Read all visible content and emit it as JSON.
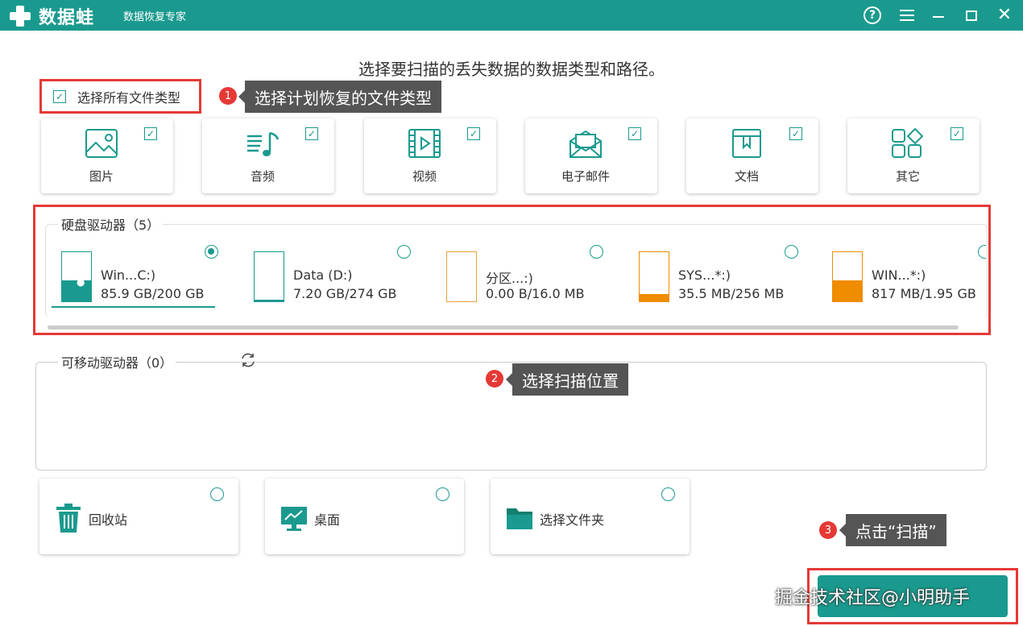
{
  "app": {
    "name": "数据蛙",
    "subtitle": "数据恢复专家",
    "help_icon": "?",
    "close_icon": "✕"
  },
  "instruction": "选择要扫描的丢失数据的数据类型和路径。",
  "select_all": {
    "label": "选择所有文件类型",
    "checked": true
  },
  "callouts": [
    {
      "num": "1",
      "text": "选择计划恢复的文件类型"
    },
    {
      "num": "2",
      "text": "选择扫描位置"
    },
    {
      "num": "3",
      "text": "点击“扫描”"
    }
  ],
  "file_types": [
    {
      "label": "图片",
      "icon": "image-icon",
      "checked": true
    },
    {
      "label": "音频",
      "icon": "music-icon",
      "checked": true
    },
    {
      "label": "视频",
      "icon": "video-icon",
      "checked": true
    },
    {
      "label": "电子邮件",
      "icon": "email-icon",
      "checked": true
    },
    {
      "label": "文档",
      "icon": "document-icon",
      "checked": true
    },
    {
      "label": "其它",
      "icon": "other-icon",
      "checked": true
    }
  ],
  "hard_drives": {
    "title": "硬盘驱动器（5）",
    "items": [
      {
        "name": "Win...C:)",
        "size": "85.9 GB/200 GB",
        "used_fraction": 0.43,
        "color": "#1a9a8e",
        "selected": true
      },
      {
        "name": "Data (D:)",
        "size": "7.20 GB/274 GB",
        "used_fraction": 0.03,
        "color": "#1a9a8e",
        "selected": false
      },
      {
        "name": "分区...:)",
        "size": "0.00  B/16.0 MB",
        "used_fraction": 0.0,
        "color": "#e6a23c",
        "selected": false
      },
      {
        "name": "SYS...*:)",
        "size": "35.5 MB/256 MB",
        "used_fraction": 0.14,
        "color": "#f08c00",
        "selected": false
      },
      {
        "name": "WIN...*:)",
        "size": "817 MB/1.95 GB",
        "used_fraction": 0.42,
        "color": "#f08c00",
        "selected": false
      }
    ]
  },
  "removable": {
    "title": "可移动驱动器（0）"
  },
  "locations": [
    {
      "label": "回收站",
      "icon": "recycle-bin-icon"
    },
    {
      "label": "桌面",
      "icon": "desktop-icon"
    },
    {
      "label": "选择文件夹",
      "icon": "folder-icon"
    }
  ],
  "watermark": "掘金技术社区@小明助手",
  "colors": {
    "accent": "#1a9a8e",
    "highlight": "#e53935",
    "callout_bg": "#555555"
  }
}
